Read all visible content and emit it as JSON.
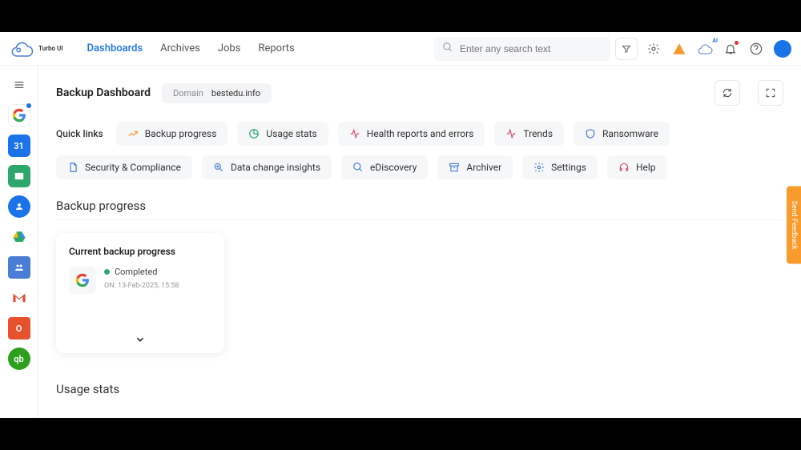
{
  "brand": "Turbo UI",
  "nav": [
    "Dashboards",
    "Archives",
    "Jobs",
    "Reports"
  ],
  "nav_active": 0,
  "search_placeholder": "Enter any search text",
  "page_title": "Backup Dashboard",
  "domain_label": "Domain",
  "domain_value": "bestedu.info",
  "quick_links_label": "Quick links",
  "quick_links": [
    {
      "label": "Backup progress",
      "icon": "trend-up",
      "color": "#f89b2c"
    },
    {
      "label": "Usage stats",
      "icon": "pie",
      "color": "#2da86c"
    },
    {
      "label": "Health reports and errors",
      "icon": "pulse",
      "color": "#d64d6a"
    },
    {
      "label": "Trends",
      "icon": "pulse",
      "color": "#d64d6a"
    },
    {
      "label": "Ransomware",
      "icon": "shield",
      "color": "#4a7dd6"
    },
    {
      "label": "Security & Compliance",
      "icon": "doc",
      "color": "#4a7dd6"
    },
    {
      "label": "Data change insights",
      "icon": "search-data",
      "color": "#4a7dd6"
    },
    {
      "label": "eDiscovery",
      "icon": "search",
      "color": "#4a7dd6"
    },
    {
      "label": "Archiver",
      "icon": "archive",
      "color": "#4a7dd6"
    },
    {
      "label": "Settings",
      "icon": "gear",
      "color": "#4a7dd6"
    },
    {
      "label": "Help",
      "icon": "headset",
      "color": "#d64d6a"
    }
  ],
  "sections": {
    "backup_progress": "Backup progress",
    "usage_stats": "Usage stats"
  },
  "card": {
    "title": "Current backup progress",
    "status": "Completed",
    "timestamp": "ON: 13-Feb-2025, 15:58"
  },
  "feedback": "Send Feedback",
  "left_icons": [
    "menu",
    "google",
    "calendar",
    "classroom",
    "contacts",
    "drive",
    "groups",
    "gmail",
    "office",
    "quickbooks"
  ],
  "colors": {
    "accent": "#1a73e8",
    "ok": "#2da86c",
    "warn": "#f89b2c"
  }
}
